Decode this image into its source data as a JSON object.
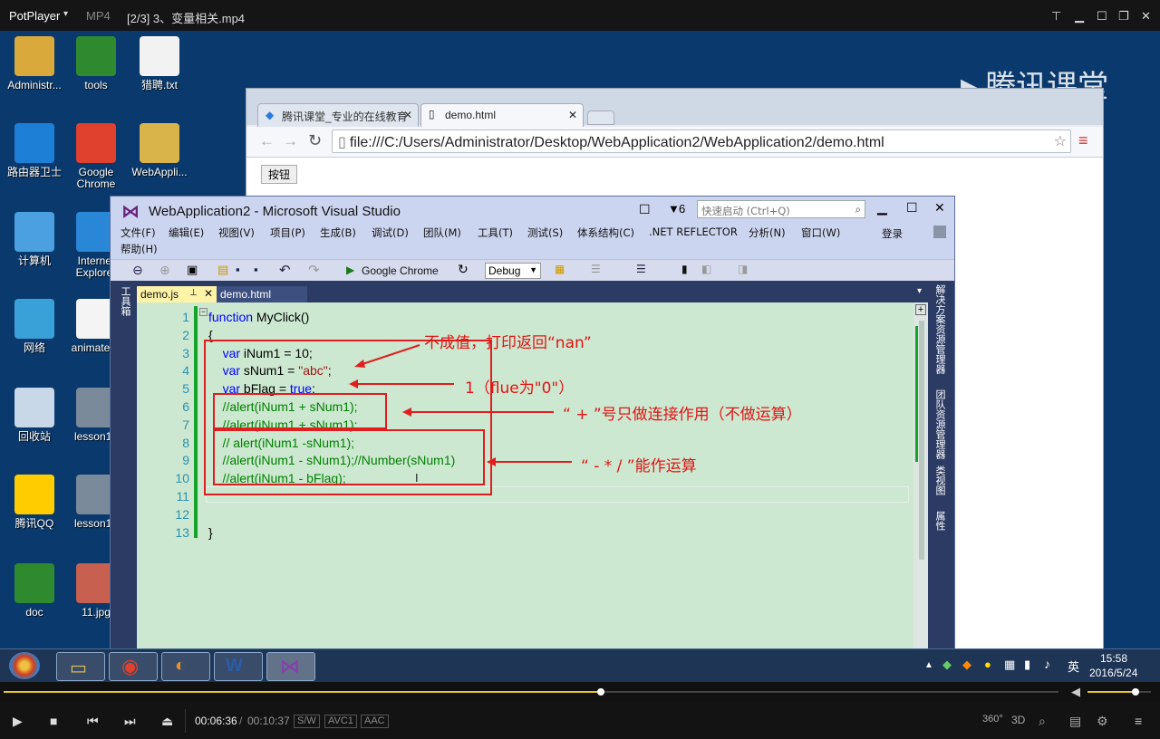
{
  "player": {
    "name": "PotPlayer",
    "format": "MP4",
    "file_title": "[2/3] 3、变量相关.mp4",
    "elapsed": "00:06:36",
    "separator": "/",
    "total": "00:10:37",
    "tags": [
      "S/W",
      "AVC1",
      "AAC"
    ],
    "progress": 0.566,
    "volume": 0.75,
    "right_labels": [
      "360°",
      "3D"
    ]
  },
  "desktop": {
    "icons": [
      {
        "label": "Administr...",
        "color": "#d9a93b"
      },
      {
        "label": "tools",
        "color": "#2f8a2f"
      },
      {
        "label": "猎聘.txt",
        "color": "#f2f2f2"
      },
      {
        "label": "路由器卫士",
        "color": "#1d7fd6"
      },
      {
        "label": "Google Chrome",
        "color": "#e0412f"
      },
      {
        "label": "WebAppli...",
        "color": "#d9b44a"
      },
      {
        "label": "计算机",
        "color": "#4aa0e0"
      },
      {
        "label": "Internet Explorer",
        "color": "#2a86d6"
      },
      {
        "label": "网络",
        "color": "#3aa0d8"
      },
      {
        "label": "animate.js",
        "color": "#f4f4f4"
      },
      {
        "label": "回收站",
        "color": "#c8d8e8"
      },
      {
        "label": "lesson12",
        "color": "#7a8a9a"
      },
      {
        "label": "腾讯QQ",
        "color": "#ffcc00"
      },
      {
        "label": "lesson13",
        "color": "#7a8a9a"
      },
      {
        "label": "doc",
        "color": "#2f8a2f"
      },
      {
        "label": "11.jpg",
        "color": "#c86050"
      }
    ],
    "watermark": "腾讯课堂"
  },
  "browser": {
    "tabs": [
      "腾讯课堂_专业的在线教育",
      "demo.html"
    ],
    "url": "file:///C:/Users/Administrator/Desktop/WebApplication2/WebApplication2/demo.html",
    "page_button": "按钮"
  },
  "vs": {
    "title": "WebApplication2 - Microsoft Visual Studio",
    "notif_count": "6",
    "quick_launch": "快速启动 (Ctrl+Q)",
    "login": "登录",
    "menu": [
      "文件(F)",
      "编辑(E)",
      "视图(V)",
      "项目(P)",
      "生成(B)",
      "调试(D)",
      "团队(M)",
      "工具(T)",
      "测试(S)",
      "体系结构(C)",
      ".NET REFLECTOR",
      "分析(N)",
      "窗口(W)",
      "帮助(H)"
    ],
    "toolbar": {
      "browser": "Google Chrome",
      "config": "Debug"
    },
    "tabs": [
      "demo.js",
      "demo.html"
    ],
    "left_panel": "工具箱",
    "right_panels": [
      "解决方案资源管理器",
      "团队资源管理器",
      "类视图",
      "属性"
    ],
    "code": [
      {
        "n": "1",
        "text": "function MyClick()"
      },
      {
        "n": "2",
        "text": "{"
      },
      {
        "n": "3",
        "text": "    var iNum1 = 10;"
      },
      {
        "n": "4",
        "text": "    var sNum1 = \"abc\";"
      },
      {
        "n": "5",
        "text": "    var bFlag = true;"
      },
      {
        "n": "6",
        "text": "    //alert(iNum1 + sNum1);"
      },
      {
        "n": "7",
        "text": "    //alert(iNum1 + sNum1);"
      },
      {
        "n": "8",
        "text": "    // alert(iNum1 -sNum1);"
      },
      {
        "n": "9",
        "text": "    //alert(iNum1 - sNum1);//Number(sNum1)"
      },
      {
        "n": "10",
        "text": "    //alert(iNum1 - bFlag);"
      },
      {
        "n": "11",
        "text": ""
      },
      {
        "n": "12",
        "text": ""
      },
      {
        "n": "13",
        "text": "}"
      }
    ],
    "annotations": [
      "不成值，打印返回“nan”",
      "1（flue为\"0\"）",
      "“ + ”号只做连接作用（不做运算）",
      "“ - * / ”能作运算"
    ]
  },
  "taskbar": {
    "time": "15:58",
    "date": "2016/5/24",
    "ime": "英"
  },
  "colors": {
    "keyword": "#0000ff",
    "string": "#a31515",
    "comment": "#008000",
    "annotation": "#e31313",
    "editor_bg": "#cce8d0"
  }
}
